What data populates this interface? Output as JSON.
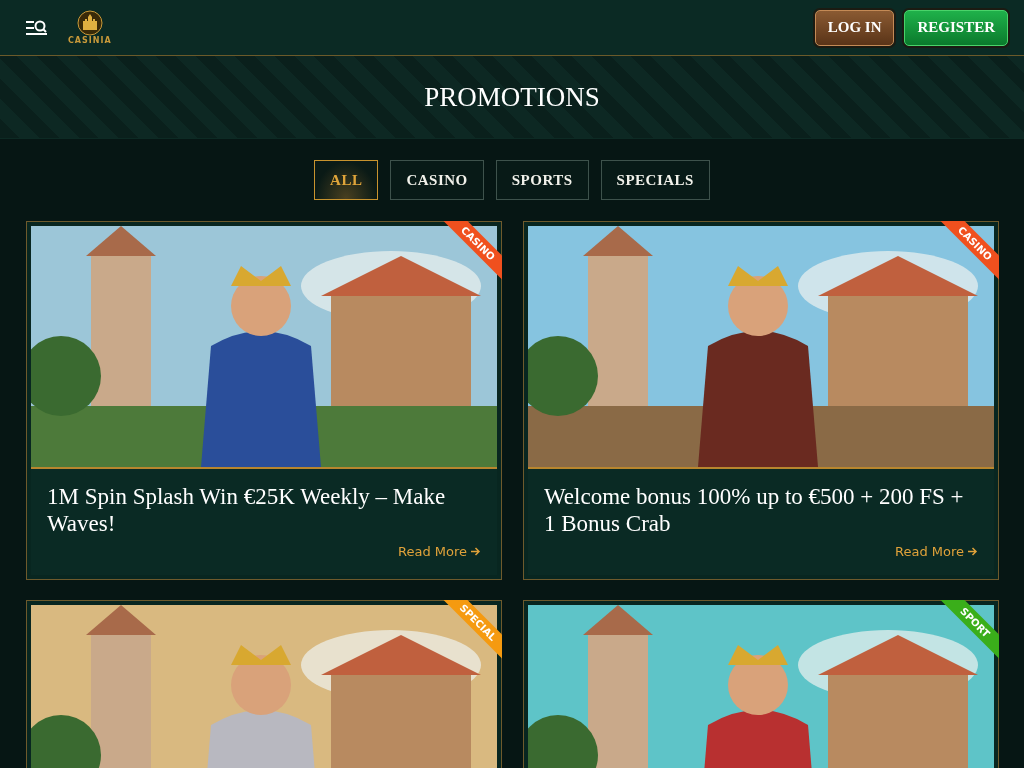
{
  "header": {
    "logo_text": "CASINIA",
    "login": "LOG IN",
    "register": "REGISTER"
  },
  "page_title": "PROMOTIONS",
  "filters": [
    {
      "label": "ALL",
      "selected": true
    },
    {
      "label": "CASINO",
      "selected": false
    },
    {
      "label": "SPORTS",
      "selected": false
    },
    {
      "label": "SPECIALS",
      "selected": false
    }
  ],
  "promotions": [
    {
      "ribbon": "CASINO",
      "color": "#f0501e",
      "title": "1M Spin Splash Win €25K Weekly – Make Waves!",
      "link": "Read More"
    },
    {
      "ribbon": "CASINO",
      "color": "#f0501e",
      "title": "Welcome bonus 100% up to €500 + 200 FS + 1 Bonus Crab",
      "link": "Read More"
    },
    {
      "ribbon": "SPECIAL",
      "color": "#f59a10"
    },
    {
      "ribbon": "SPORT",
      "color": "#3aae1a"
    }
  ]
}
